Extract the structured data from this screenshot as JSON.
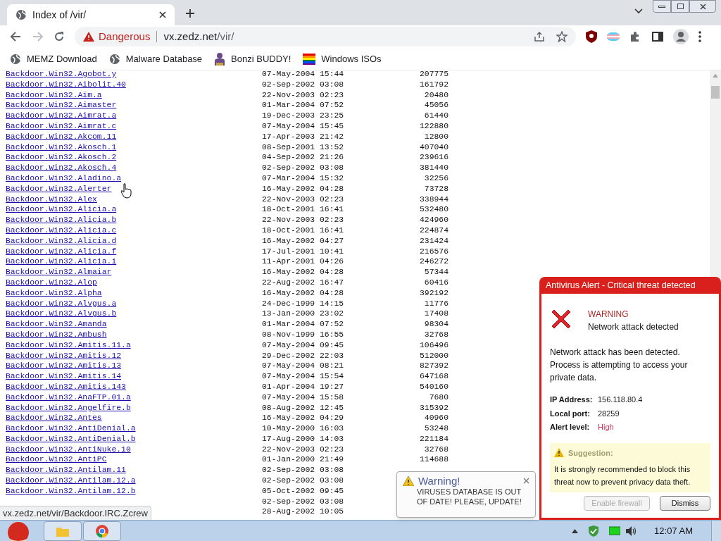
{
  "browser": {
    "tab_title": "Index of /vir/",
    "address": {
      "warning": "Dangerous",
      "host": "vx.zedz.net",
      "path": "/vir/"
    },
    "bookmarks": [
      {
        "label": "MEMZ Download",
        "kind": "globe"
      },
      {
        "label": "Malware Database",
        "kind": "globe"
      },
      {
        "label": "Bonzi BUDDY!",
        "kind": "figure"
      },
      {
        "label": "Windows ISOs",
        "kind": "flag"
      }
    ]
  },
  "listing": {
    "rows": [
      {
        "name": "Backdoor.Win32.Agobot.y",
        "date": "07-May-2004 15:44",
        "size": "207775"
      },
      {
        "name": "Backdoor.Win32.Aibolit.40",
        "date": "02-Sep-2002 03:08",
        "size": "161792"
      },
      {
        "name": "Backdoor.Win32.Aim.a",
        "date": "22-Nov-2003 02:23",
        "size": "20480"
      },
      {
        "name": "Backdoor.Win32.Aimaster",
        "date": "01-Mar-2004 07:52",
        "size": "45056"
      },
      {
        "name": "Backdoor.Win32.Aimrat.a",
        "date": "19-Dec-2003 23:25",
        "size": "61440"
      },
      {
        "name": "Backdoor.Win32.Aimrat.c",
        "date": "07-May-2004 15:45",
        "size": "122880"
      },
      {
        "name": "Backdoor.Win32.Akcom.11",
        "date": "17-Apr-2003 21:42",
        "size": "12800"
      },
      {
        "name": "Backdoor.Win32.Akosch.1",
        "date": "08-Sep-2001 13:52",
        "size": "407040"
      },
      {
        "name": "Backdoor.Win32.Akosch.2",
        "date": "04-Sep-2002 21:26",
        "size": "239616"
      },
      {
        "name": "Backdoor.Win32.Akosch.4",
        "date": "02-Sep-2002 03:08",
        "size": "381440"
      },
      {
        "name": "Backdoor.Win32.Aladino.a",
        "date": "07-Mar-2004 15:32",
        "size": "32256"
      },
      {
        "name": "Backdoor.Win32.Alerter",
        "date": "16-May-2002 04:28",
        "size": "73728"
      },
      {
        "name": "Backdoor.Win32.Alex",
        "date": "22-Nov-2003 02:23",
        "size": "338944"
      },
      {
        "name": "Backdoor.Win32.Alicia.a",
        "date": "18-Oct-2001 16:41",
        "size": "532480"
      },
      {
        "name": "Backdoor.Win32.Alicia.b",
        "date": "22-Nov-2003 02:23",
        "size": "424960"
      },
      {
        "name": "Backdoor.Win32.Alicia.c",
        "date": "18-Oct-2001 16:41",
        "size": "224874"
      },
      {
        "name": "Backdoor.Win32.Alicia.d",
        "date": "16-May-2002 04:27",
        "size": "231424"
      },
      {
        "name": "Backdoor.Win32.Alicia.f",
        "date": "17-Jul-2001 10:41",
        "size": "216576"
      },
      {
        "name": "Backdoor.Win32.Alicia.i",
        "date": "11-Apr-2001 04:26",
        "size": "246272"
      },
      {
        "name": "Backdoor.Win32.Almaiar",
        "date": "16-May-2002 04:28",
        "size": "57344"
      },
      {
        "name": "Backdoor.Win32.Alop",
        "date": "22-Aug-2002 16:47",
        "size": "60416"
      },
      {
        "name": "Backdoor.Win32.Alpha",
        "date": "16-May-2002 04:28",
        "size": "392192"
      },
      {
        "name": "Backdoor.Win32.Alvgus.a",
        "date": "24-Dec-1999 14:15",
        "size": "11776"
      },
      {
        "name": "Backdoor.Win32.Alvgus.b",
        "date": "13-Jan-2000 23:02",
        "size": "17408"
      },
      {
        "name": "Backdoor.Win32.Amanda",
        "date": "01-Mar-2004 07:52",
        "size": "98304"
      },
      {
        "name": "Backdoor.Win32.Ambush",
        "date": "08-Nov-1999 16:55",
        "size": "32768"
      },
      {
        "name": "Backdoor.Win32.Amitis.11.a",
        "date": "07-May-2004 09:45",
        "size": "106496"
      },
      {
        "name": "Backdoor.Win32.Amitis.12",
        "date": "29-Dec-2002 22:03",
        "size": "512000"
      },
      {
        "name": "Backdoor.Win32.Amitis.13",
        "date": "07-May-2004 08:21",
        "size": "827392"
      },
      {
        "name": "Backdoor.Win32.Amitis.14",
        "date": "07-May-2004 15:54",
        "size": "647168"
      },
      {
        "name": "Backdoor.Win32.Amitis.143",
        "date": "01-Apr-2004 19:27",
        "size": "540160"
      },
      {
        "name": "Backdoor.Win32.AnaFTP.01.a",
        "date": "07-May-2004 15:58",
        "size": "7680"
      },
      {
        "name": "Backdoor.Win32.Angelfire.b",
        "date": "08-Aug-2002 12:45",
        "size": "315392"
      },
      {
        "name": "Backdoor.Win32.Antes",
        "date": "16-May-2002 04:29",
        "size": "40960"
      },
      {
        "name": "Backdoor.Win32.AntiDenial.a",
        "date": "10-May-2000 16:03",
        "size": "53248"
      },
      {
        "name": "Backdoor.Win32.AntiDenial.b",
        "date": "17-Aug-2000 14:03",
        "size": "221184"
      },
      {
        "name": "Backdoor.Win32.AntiNuke.10",
        "date": "22-Nov-2003 02:23",
        "size": "32768"
      },
      {
        "name": "Backdoor.Win32.AntiPC",
        "date": "01-Jan-2000 21:49",
        "size": "114688"
      },
      {
        "name": "Backdoor.Win32.Antilam.11",
        "date": "02-Sep-2002 03:08"
      },
      {
        "name": "Backdoor.Win32.Antilam.12.a",
        "date": "02-Sep-2002 03:08"
      },
      {
        "name": "Backdoor.Win32.Antilam.12.b",
        "date": "05-Oct-2002 09:45"
      },
      {
        "date": "02-Sep-2002 03:08"
      },
      {
        "date": "28-Aug-2002 10:05"
      }
    ]
  },
  "status_url": "vx.zedz.net/vir/Backdoor.IRC.Zcrew",
  "alert": {
    "title": "Antivirus Alert - Critical threat detected",
    "heading": "WARNING",
    "subheading": "Network attack detected",
    "message": "Network attack has been detected. Process is attempting to access your private data.",
    "details": [
      {
        "label": "IP Address:",
        "value": "156.118.80.4",
        "kind": "normal"
      },
      {
        "label": "Local port:",
        "value": "28259",
        "kind": "normal"
      },
      {
        "label": "Alert level:",
        "value": "High",
        "kind": "danger"
      }
    ],
    "suggestion_title": "Suggestion:",
    "suggestion": "It is strongly recommended to block this threat now to prevent privacy data theft.",
    "buttons": [
      "Enable firewall",
      "Dismiss"
    ]
  },
  "toast": {
    "title": "Warning!",
    "message": "VIRUSES DATABASE IS OUT OF DATE! PLEASE, UPDATE!"
  },
  "taskbar": {
    "clock": "12:07 AM"
  }
}
